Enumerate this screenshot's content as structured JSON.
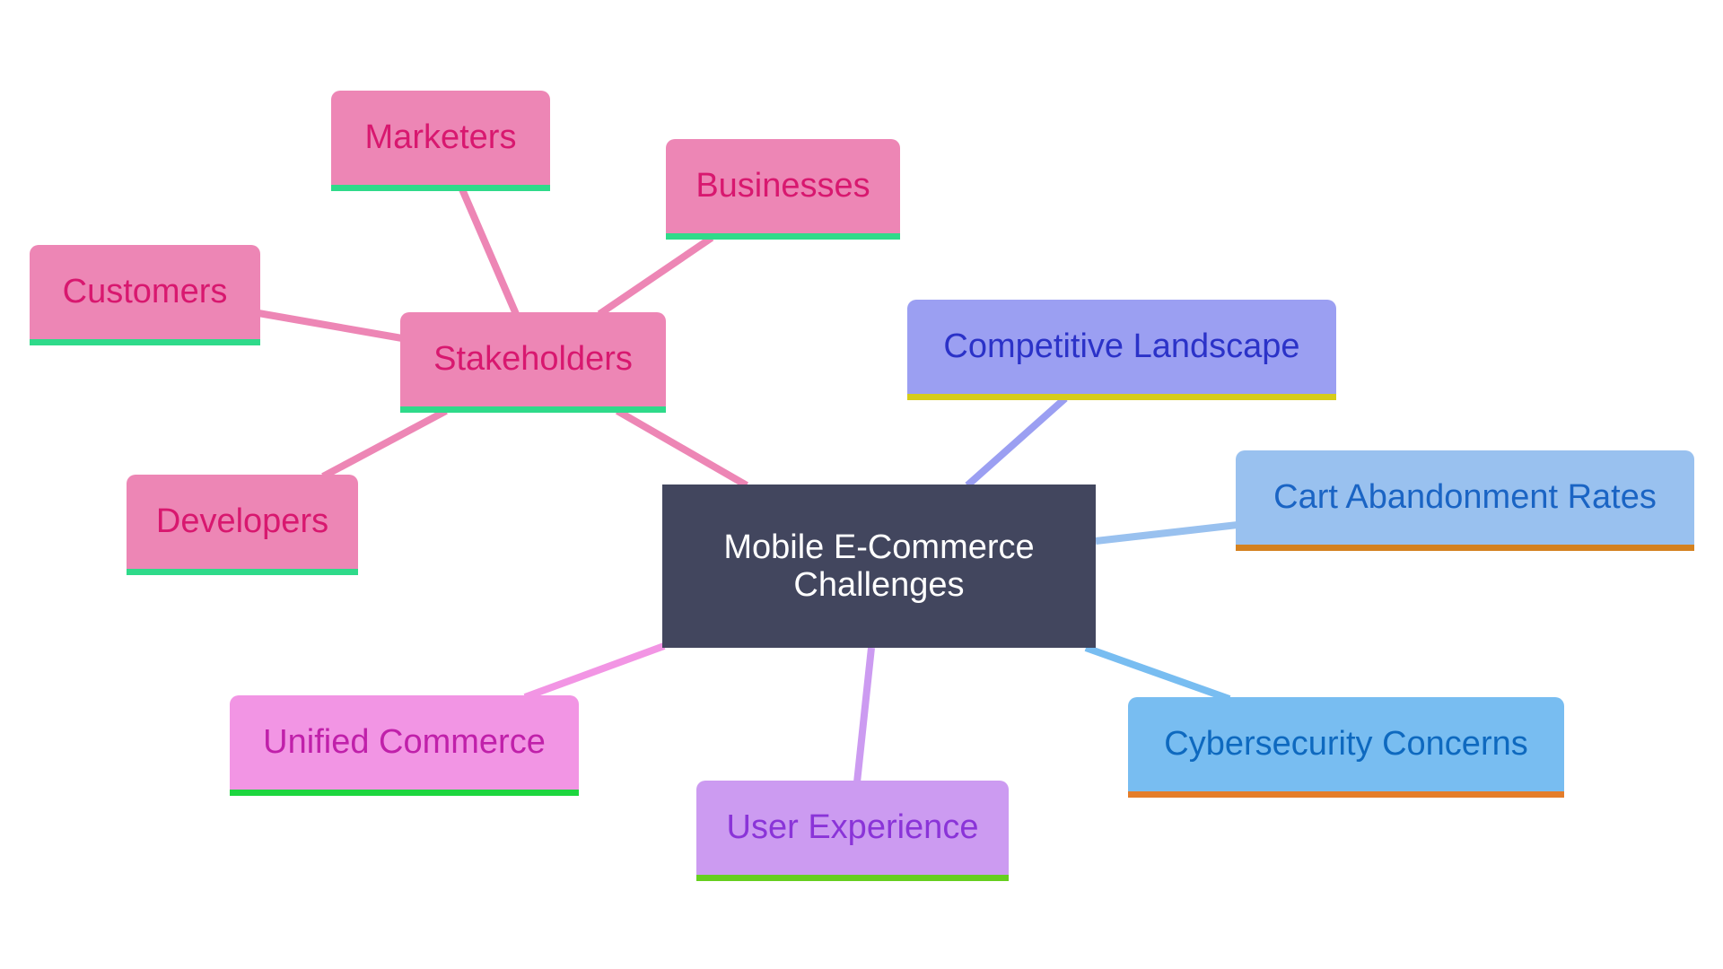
{
  "diagram": {
    "type": "mindmap",
    "root": {
      "id": "root",
      "label": "Mobile E-Commerce\nChallenges",
      "fill": "#42465e",
      "text_color": "#ffffff"
    },
    "nodes": [
      {
        "id": "stakeholders",
        "label": "Stakeholders",
        "parent": "root",
        "fill": "#ed86b5",
        "text_color": "#d8186f",
        "bar_color": "#2fda8a",
        "edge_color": "#ed86b5"
      },
      {
        "id": "marketers",
        "label": "Marketers",
        "parent": "stakeholders",
        "fill": "#ed86b5",
        "text_color": "#d8186f",
        "bar_color": "#2fda8a",
        "edge_color": "#ed86b5"
      },
      {
        "id": "businesses",
        "label": "Businesses",
        "parent": "stakeholders",
        "fill": "#ed86b5",
        "text_color": "#d8186f",
        "bar_color": "#2fda8a",
        "edge_color": "#ed86b5"
      },
      {
        "id": "customers",
        "label": "Customers",
        "parent": "stakeholders",
        "fill": "#ed86b5",
        "text_color": "#d8186f",
        "bar_color": "#2fda8a",
        "edge_color": "#ed86b5"
      },
      {
        "id": "developers",
        "label": "Developers",
        "parent": "stakeholders",
        "fill": "#ed86b5",
        "text_color": "#d8186f",
        "bar_color": "#2fda8a",
        "edge_color": "#ed86b5"
      },
      {
        "id": "competitive",
        "label": "Competitive Landscape",
        "parent": "root",
        "fill": "#9b9ff2",
        "text_color": "#2b32c8",
        "bar_color": "#d6cc1a",
        "edge_color": "#9b9ff2"
      },
      {
        "id": "cart",
        "label": "Cart Abandonment Rates",
        "parent": "root",
        "fill": "#99c1ef",
        "text_color": "#1a64c4",
        "bar_color": "#d4811f",
        "edge_color": "#99c1ef"
      },
      {
        "id": "cyber",
        "label": "Cybersecurity Concerns",
        "parent": "root",
        "fill": "#78bdf1",
        "text_color": "#0e69bf",
        "bar_color": "#e47d2a",
        "edge_color": "#78bdf1"
      },
      {
        "id": "ux",
        "label": "User Experience",
        "parent": "root",
        "fill": "#cc9bf1",
        "text_color": "#8a34d8",
        "bar_color": "#66cf1f",
        "edge_color": "#cc9bf1"
      },
      {
        "id": "unified",
        "label": "Unified Commerce",
        "parent": "root",
        "fill": "#f295e4",
        "text_color": "#c020aa",
        "bar_color": "#1dd63f",
        "edge_color": "#f295e4"
      }
    ]
  }
}
